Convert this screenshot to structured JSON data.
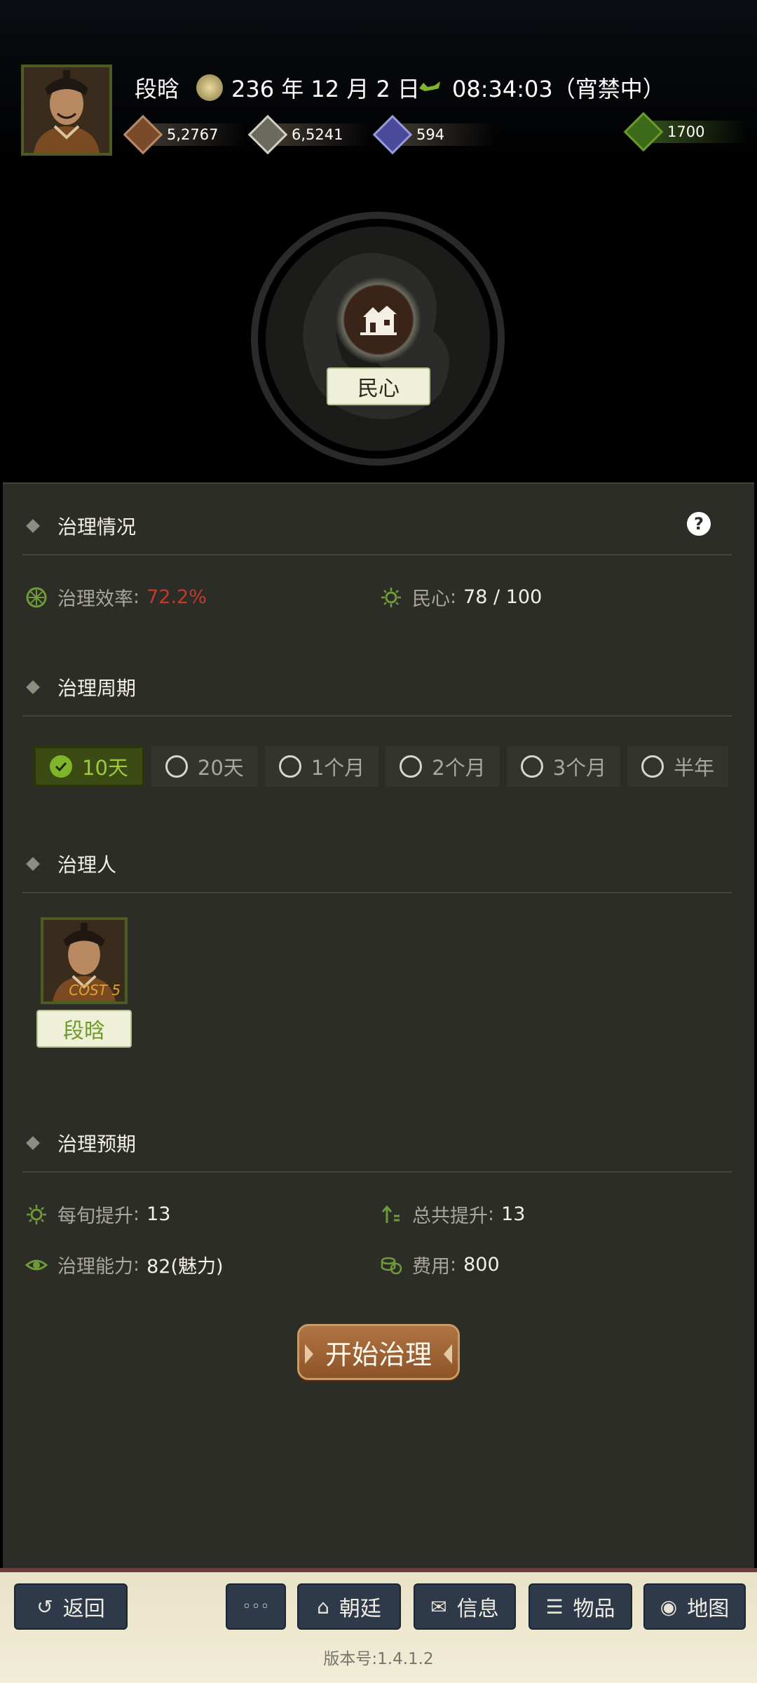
{
  "header": {
    "name": "段晗",
    "date": "236 年 12 月 2 日",
    "time": "08:34:03（宵禁中）",
    "resources": [
      {
        "icon": "coin-bag-icon",
        "value": "5,2767",
        "color": "#7a4a2a"
      },
      {
        "icon": "grain-icon",
        "value": "6,5241",
        "color": "#8a8a80"
      },
      {
        "icon": "soldier-icon",
        "value": "594",
        "color": "#4a4a9a"
      },
      {
        "icon": "potion-icon",
        "value": "1700",
        "color": "#3c6a1a"
      }
    ]
  },
  "emblem": {
    "label": "民心"
  },
  "sections": {
    "status": {
      "title": "治理情况",
      "efficiency_label": "治理效率",
      "efficiency_value": "72.2%",
      "minxin_label": "民心",
      "minxin_value": "78 / 100"
    },
    "period": {
      "title": "治理周期",
      "options": [
        "10天",
        "20天",
        "1个月",
        "2个月",
        "3个月",
        "半年"
      ],
      "selected": "10天"
    },
    "governor": {
      "title": "治理人",
      "name": "段晗",
      "cost": "COST 5"
    },
    "forecast": {
      "title": "治理预期",
      "per_label": "每旬提升",
      "per_value": "13",
      "total_label": "总共提升",
      "total_value": "13",
      "ability_label": "治理能力",
      "ability_value": "82(魅力)",
      "fee_label": "费用",
      "fee_value": "800"
    }
  },
  "start_button": "开始治理",
  "bottom_bar": {
    "back": "返回",
    "more": "◦◦◦",
    "court": "朝廷",
    "info": "信息",
    "items": "物品",
    "map": "地图",
    "version": "版本号:1.4.1.2"
  },
  "colors": {
    "accent_green": "#7fb52a",
    "efficiency_red": "#c23a2e",
    "button_brown": "#9a5f30"
  }
}
